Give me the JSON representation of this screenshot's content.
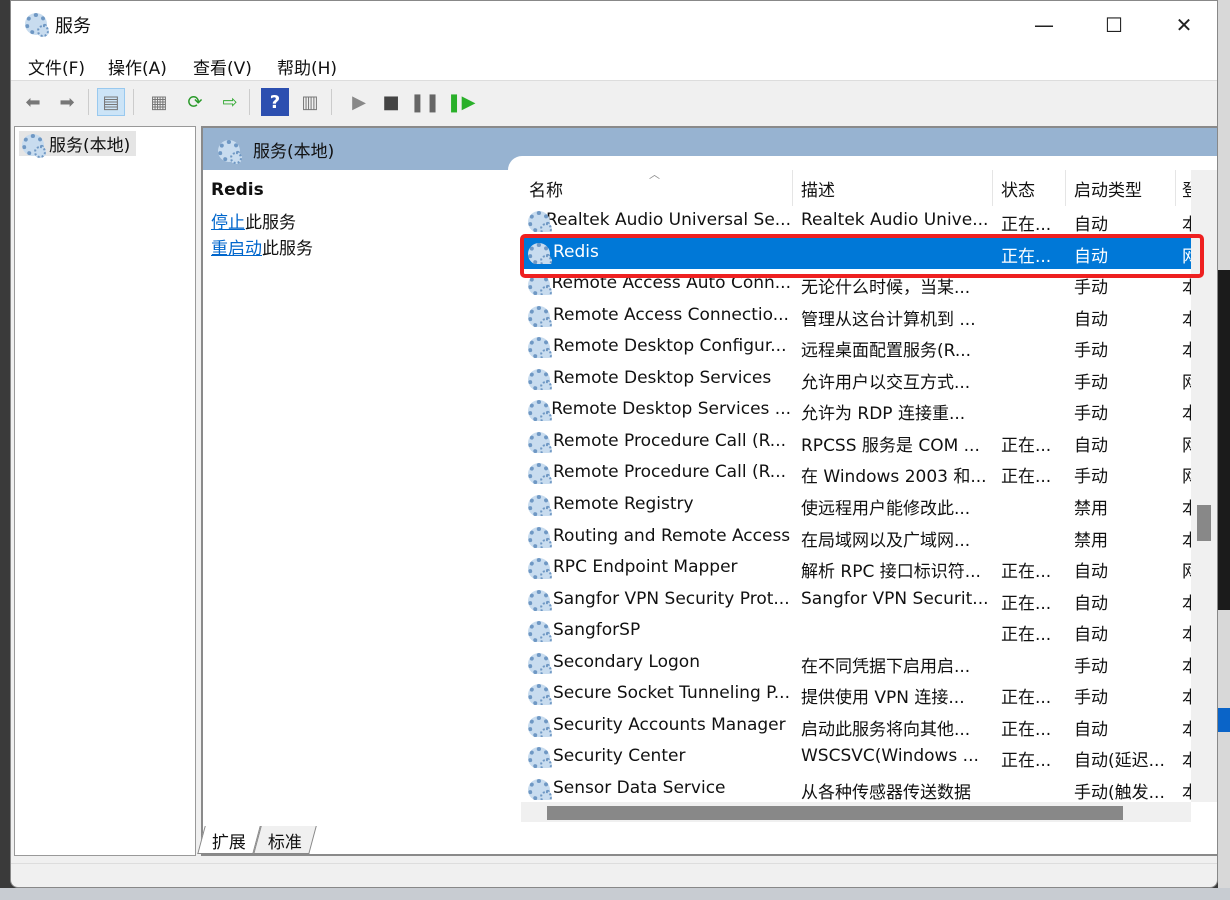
{
  "window": {
    "title": "服务",
    "minimize": "—",
    "maximize": "☐",
    "close": "✕"
  },
  "menu": [
    "文件(F)",
    "操作(A)",
    "查看(V)",
    "帮助(H)"
  ],
  "toolbar": [
    "back-icon",
    "forward-icon",
    "show-hide-console-tree-icon",
    "properties-icon",
    "refresh-icon",
    "export-list-icon",
    "help-icon",
    "show-action-pane-icon",
    "start-service-icon",
    "stop-service-icon",
    "pause-service-icon",
    "restart-service-icon"
  ],
  "tree": {
    "root": "服务(本地)"
  },
  "panel": {
    "title": "服务(本地)"
  },
  "details": {
    "name": "Redis",
    "stop_link": "停止",
    "stop_suffix": "此服务",
    "restart_link": "重启动",
    "restart_suffix": "此服务"
  },
  "columns": [
    "名称",
    "描述",
    "状态",
    "启动类型",
    "登录为"
  ],
  "rows": [
    {
      "name": "Realtek Audio Universal Se...",
      "desc": "Realtek Audio Unive...",
      "status": "正在...",
      "startup": "自动",
      "logon": "本地系统"
    },
    {
      "name": "Redis",
      "desc": "",
      "status": "正在...",
      "startup": "自动",
      "logon": "网络服务",
      "selected": true
    },
    {
      "name": "Remote Access Auto Conn...",
      "desc": "无论什么时候，当某...",
      "status": "",
      "startup": "手动",
      "logon": "本地系统"
    },
    {
      "name": "Remote Access Connectio...",
      "desc": "管理从这台计算机到 ...",
      "status": "",
      "startup": "自动",
      "logon": "本地系统"
    },
    {
      "name": "Remote Desktop Configur...",
      "desc": "远程桌面配置服务(R...",
      "status": "",
      "startup": "手动",
      "logon": "本地系统"
    },
    {
      "name": "Remote Desktop Services",
      "desc": "允许用户以交互方式...",
      "status": "",
      "startup": "手动",
      "logon": "网络服务"
    },
    {
      "name": "Remote Desktop Services ...",
      "desc": "允许为 RDP 连接重...",
      "status": "",
      "startup": "手动",
      "logon": "本地系统"
    },
    {
      "name": "Remote Procedure Call (R...",
      "desc": "RPCSS 服务是 COM ...",
      "status": "正在...",
      "startup": "自动",
      "logon": "网络服务"
    },
    {
      "name": "Remote Procedure Call (R...",
      "desc": "在 Windows 2003 和...",
      "status": "正在...",
      "startup": "手动",
      "logon": "网络服务"
    },
    {
      "name": "Remote Registry",
      "desc": "使远程用户能修改此...",
      "status": "",
      "startup": "禁用",
      "logon": "本地服务"
    },
    {
      "name": "Routing and Remote Access",
      "desc": "在局域网以及广域网...",
      "status": "",
      "startup": "禁用",
      "logon": "本地系统"
    },
    {
      "name": "RPC Endpoint Mapper",
      "desc": "解析 RPC 接口标识符...",
      "status": "正在...",
      "startup": "自动",
      "logon": "网络服务"
    },
    {
      "name": "Sangfor VPN Security Prot...",
      "desc": "Sangfor VPN Securit...",
      "status": "正在...",
      "startup": "自动",
      "logon": "本地系统"
    },
    {
      "name": "SangforSP",
      "desc": "",
      "status": "正在...",
      "startup": "自动",
      "logon": "本地系统"
    },
    {
      "name": "Secondary Logon",
      "desc": "在不同凭据下启用启...",
      "status": "",
      "startup": "手动",
      "logon": "本地系统"
    },
    {
      "name": "Secure Socket Tunneling P...",
      "desc": "提供使用 VPN 连接...",
      "status": "正在...",
      "startup": "手动",
      "logon": "本地服务"
    },
    {
      "name": "Security Accounts Manager",
      "desc": "启动此服务将向其他...",
      "status": "正在...",
      "startup": "自动",
      "logon": "本地系统"
    },
    {
      "name": "Security Center",
      "desc": "WSCSVC(Windows ...",
      "status": "正在...",
      "startup": "自动(延迟...",
      "logon": "本地服务"
    },
    {
      "name": "Sensor Data Service",
      "desc": "从各种传感器传送数据",
      "status": "",
      "startup": "手动(触发...",
      "logon": "本地系统"
    }
  ],
  "tabs": [
    "扩展",
    "标准"
  ],
  "colors": {
    "selection": "#0078d7",
    "panel_band": "#97b3d1",
    "highlight_box": "#ee2020",
    "link": "#0066cc"
  }
}
